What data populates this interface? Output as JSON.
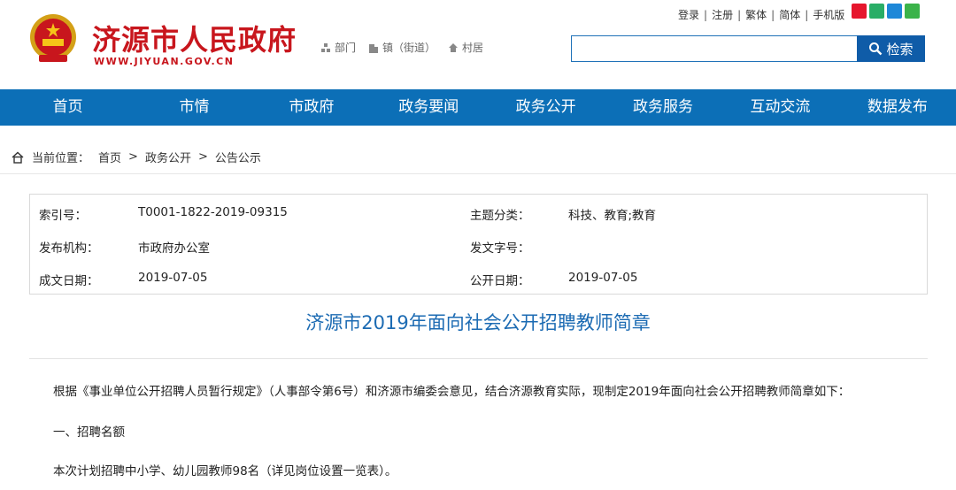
{
  "header": {
    "site_title": "济源市人民政府",
    "site_domain": "WWW.JIYUAN.GOV.CN",
    "scope_links": [
      "部门",
      "镇（街道）",
      "村居"
    ],
    "top_links": [
      "登录",
      "注册",
      "繁体",
      "简体",
      "手机版"
    ],
    "search_button": "检索",
    "search_placeholder": ""
  },
  "nav": {
    "items": [
      "首页",
      "市情",
      "市政府",
      "政务要闻",
      "政务公开",
      "政务服务",
      "互动交流",
      "数据发布"
    ]
  },
  "breadcrumb": {
    "label": "当前位置：",
    "items": [
      "首页",
      "政务公开",
      "公告公示"
    ],
    "separator": ">"
  },
  "meta": {
    "index_label": "索引号：",
    "index_value": "T0001-1822-2019-09315",
    "topic_label": "主题分类：",
    "topic_value": "科技、教育;教育",
    "publisher_label": "发布机构：",
    "publisher_value": "市政府办公室",
    "docno_label": "发文字号：",
    "docno_value": "",
    "date_label": "成文日期：",
    "date_value": "2019-07-05",
    "publish_label": "公开日期：",
    "publish_value": "2019-07-05"
  },
  "article": {
    "title": "济源市2019年面向社会公开招聘教师简章",
    "paragraphs": [
      "根据《事业单位公开招聘人员暂行规定》（人事部令第6号）和济源市编委会意见，结合济源教育实际，现制定2019年面向社会公开招聘教师简章如下：",
      "一、招聘名额",
      "本次计划招聘中小学、幼儿园教师98名（详见岗位设置一览表）。"
    ]
  }
}
